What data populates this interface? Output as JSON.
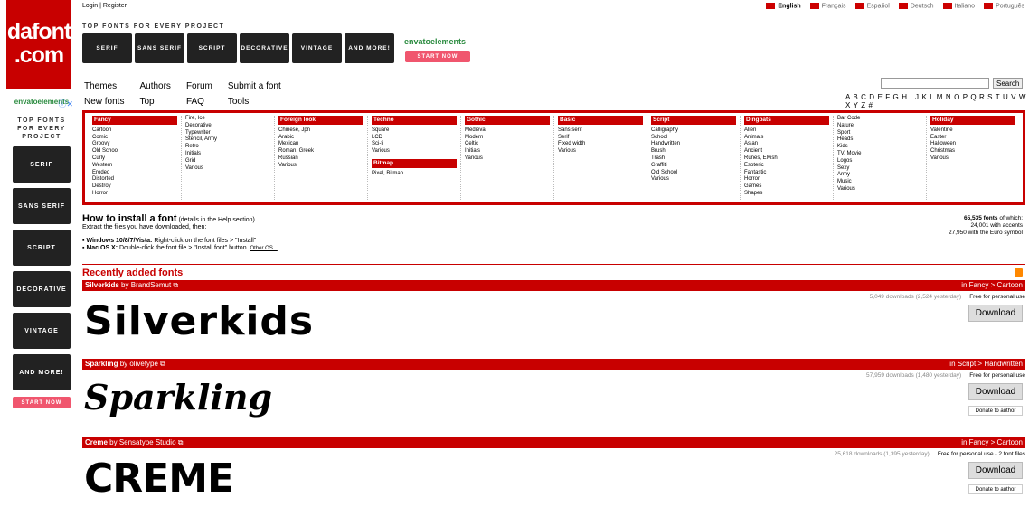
{
  "logo": {
    "line1": "dafont",
    "line2": ".com"
  },
  "topbar": {
    "login": "Login",
    "sep": "|",
    "register": "Register",
    "languages": [
      "English",
      "Français",
      "Español",
      "Deutsch",
      "Italiano",
      "Português"
    ]
  },
  "side_ad": {
    "brand": "envatoelements",
    "headline": "TOP FONTS FOR EVERY PROJECT",
    "tiles": [
      "SERIF",
      "SANS SERIF",
      "SCRIPT",
      "DECORATIVE",
      "VINTAGE",
      "AND MORE!"
    ],
    "cta": "START NOW"
  },
  "top_ad": {
    "headline": "TOP FONTS FOR EVERY PROJECT",
    "brand": "envatoelements",
    "tiles": [
      "SERIF",
      "SANS SERIF",
      "SCRIPT",
      "DECORATIVE",
      "VINTAGE",
      "AND MORE!"
    ],
    "cta": "START NOW"
  },
  "nav": {
    "themes": "Themes",
    "authors": "Authors",
    "forum": "Forum",
    "submit": "Submit a font",
    "new_fonts": "New fonts",
    "top": "Top",
    "faq": "FAQ",
    "tools": "Tools"
  },
  "search": {
    "button": "Search",
    "value": ""
  },
  "alphabet": "A B C D E F G H I J K L M N O P Q R S T U V W X Y Z #",
  "categories": [
    {
      "title": "Fancy",
      "items": [
        "Cartoon",
        "Comic",
        "Groovy",
        "Old School",
        "Curly",
        "Western",
        "Eroded",
        "Distorted",
        "Destroy",
        "Horror"
      ]
    },
    {
      "title": "",
      "items": [
        "Fire, Ice",
        "Decorative",
        "Typewriter",
        "Stencil, Army",
        "Retro",
        "Initials",
        "Grid",
        "Various"
      ]
    },
    {
      "title": "Foreign look",
      "items": [
        "Chinese, Jpn",
        "Arabic",
        "Mexican",
        "Roman, Greek",
        "Russian",
        "Various"
      ]
    },
    {
      "title": "Techno",
      "items": [
        "Square",
        "LCD",
        "Sci-fi",
        "Various"
      ],
      "title2": "Bitmap",
      "items2": [
        "Pixel, Bitmap"
      ]
    },
    {
      "title": "Gothic",
      "items": [
        "Medieval",
        "Modern",
        "Celtic",
        "Initials",
        "Various"
      ]
    },
    {
      "title": "Basic",
      "items": [
        "Sans serif",
        "Serif",
        "Fixed width",
        "Various"
      ]
    },
    {
      "title": "Script",
      "items": [
        "Calligraphy",
        "School",
        "Handwritten",
        "Brush",
        "Trash",
        "Graffiti",
        "Old School",
        "Various"
      ]
    },
    {
      "title": "Dingbats",
      "items": [
        "Alien",
        "Animals",
        "Asian",
        "Ancient",
        "Runes, Elvish",
        "Esoteric",
        "Fantastic",
        "Horror",
        "Games",
        "Shapes"
      ]
    },
    {
      "title": "",
      "items": [
        "Bar Code",
        "Nature",
        "Sport",
        "Heads",
        "Kids",
        "TV, Movie",
        "Logos",
        "Sexy",
        "Army",
        "Music",
        "Various"
      ]
    },
    {
      "title": "Holiday",
      "items": [
        "Valentine",
        "Easter",
        "Halloween",
        "Christmas",
        "Various"
      ]
    }
  ],
  "install": {
    "title": "How to install a font",
    "detail": "(details in the Help section)",
    "extract": "Extract the files you have downloaded, then:",
    "win_label": "Windows 10/8/7/Vista:",
    "win_text": "Right-click on the font files > \"Install\"",
    "mac_label": "Mac OS X:",
    "mac_text": "Double-click the font file > \"Install font\" button.",
    "other": "Other OS..."
  },
  "stats": {
    "count": "65,535 fonts",
    "of_which": "of which:",
    "accents": "24,001 with accents",
    "euro": "27,950 with the Euro symbol"
  },
  "recent": {
    "title": "Recently added fonts"
  },
  "fonts": [
    {
      "name": "Silverkids",
      "by": "by BrandSemut",
      "cat": "in Fancy > Cartoon",
      "downloads": "5,049 downloads (2,524 yesterday)",
      "license": "Free for personal use",
      "download": "Download",
      "preview": "Silverkids",
      "donate": ""
    },
    {
      "name": "Sparkling",
      "by": "by olivetype",
      "cat": "in Script > Handwritten",
      "downloads": "57,959 downloads (1,480 yesterday)",
      "license": "Free for personal use",
      "download": "Download",
      "preview": "Sparkling",
      "donate": "Donate to author"
    },
    {
      "name": "Creme",
      "by": "by Sensatype Studio",
      "cat": "in Fancy > Cartoon",
      "downloads": "25,618 downloads (1,395 yesterday)",
      "license": "Free for personal use - 2 font files",
      "download": "Download",
      "preview": "CREME",
      "donate": "Donate to author"
    }
  ]
}
